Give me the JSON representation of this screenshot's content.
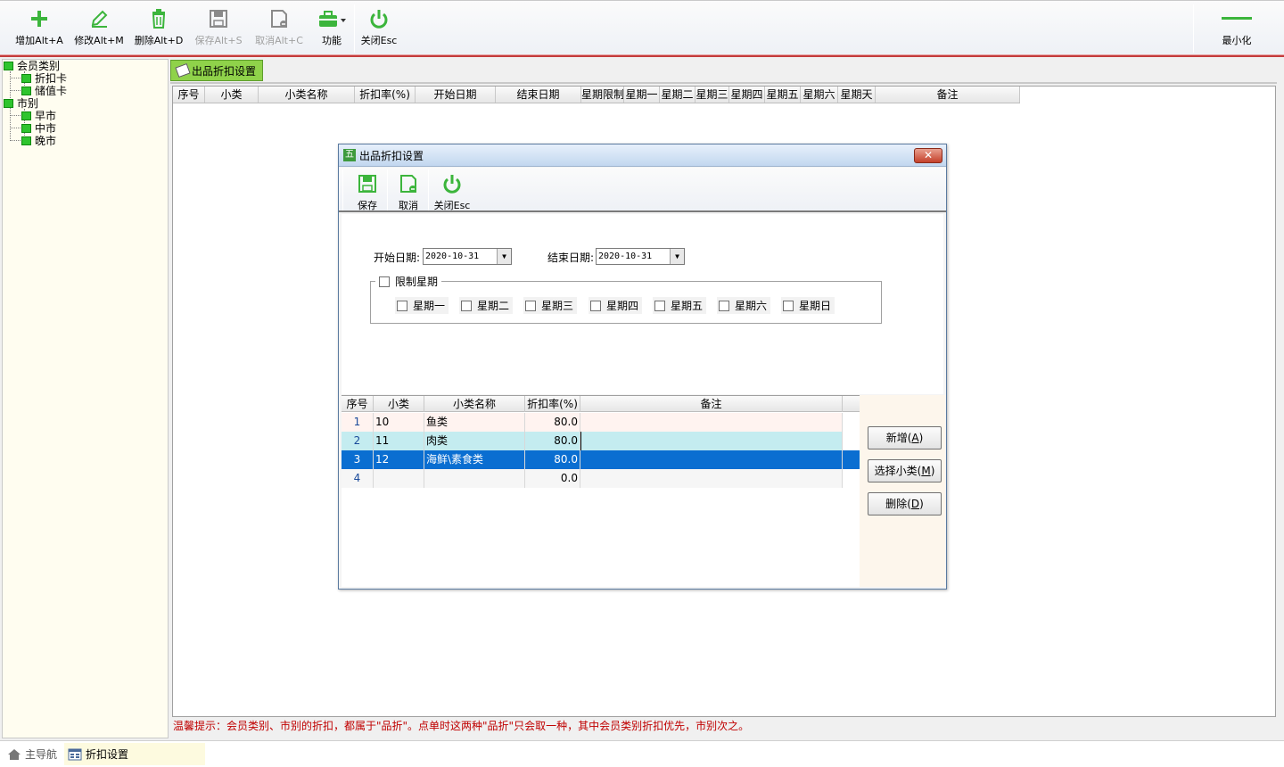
{
  "toolbar": {
    "add": "增加Alt+A",
    "edit": "修改Alt+M",
    "delete": "删除Alt+D",
    "save": "保存Alt+S",
    "cancel": "取消Alt+C",
    "function": "功能",
    "close": "关闭Esc",
    "minimize": "最小化"
  },
  "tree": {
    "member_category": "会员类别",
    "discount_card": "折扣卡",
    "stored_value_card": "储值卡",
    "market": "市别",
    "morning_market": "早市",
    "midday_market": "中市",
    "evening_market": "晚市"
  },
  "tab": {
    "label": "出品折扣设置"
  },
  "main_grid": {
    "columns": [
      "序号",
      "小类",
      "小类名称",
      "折扣率(%)",
      "开始日期",
      "结束日期",
      "星期限制",
      "星期一",
      "星期二",
      "星期三",
      "星期四",
      "星期五",
      "星期六",
      "星期天",
      "备注"
    ]
  },
  "tip": "温馨提示：会员类别、市别的折扣，都属于\"品折\"。点单时这两种\"品折\"只会取一种，其中会员类别折扣优先，市别次之。",
  "statusbar": {
    "home": "主导航",
    "active": "折扣设置"
  },
  "dialog": {
    "title": "出品折扣设置",
    "close_glyph": "✕",
    "toolbar": {
      "save": "保存",
      "cancel": "取消",
      "close": "关闭Esc"
    },
    "start_label": "开始日期:",
    "start_value": "2020-10-31",
    "end_label": "结束日期:",
    "end_value": "2020-10-31",
    "limit_week": "限制星期",
    "weekdays": [
      "星期一",
      "星期二",
      "星期三",
      "星期四",
      "星期五",
      "星期六",
      "星期日"
    ],
    "grid": {
      "columns": [
        "序号",
        "小类",
        "小类名称",
        "折扣率(%)",
        "备注"
      ],
      "rows": [
        {
          "no": "1",
          "code": "10",
          "name": "鱼类",
          "rate": "80.0",
          "note": ""
        },
        {
          "no": "2",
          "code": "11",
          "name": "肉类",
          "rate": "80.0",
          "note": ""
        },
        {
          "no": "3",
          "code": "12",
          "name": "海鲜\\素食类",
          "rate": "80.0",
          "note": ""
        },
        {
          "no": "4",
          "code": "",
          "name": "",
          "rate": "0.0",
          "note": ""
        }
      ]
    },
    "buttons": {
      "add": "新增",
      "add_key": "A",
      "select": "选择小类",
      "select_key": "M",
      "delete": "删除",
      "delete_key": "D"
    }
  },
  "colors": {
    "accent_green": "#3cb53c",
    "tab_green": "#8fd24a",
    "row_selected": "#0a6ed1",
    "row_alt": "#c4ecf0",
    "tip_red": "#c00000"
  }
}
